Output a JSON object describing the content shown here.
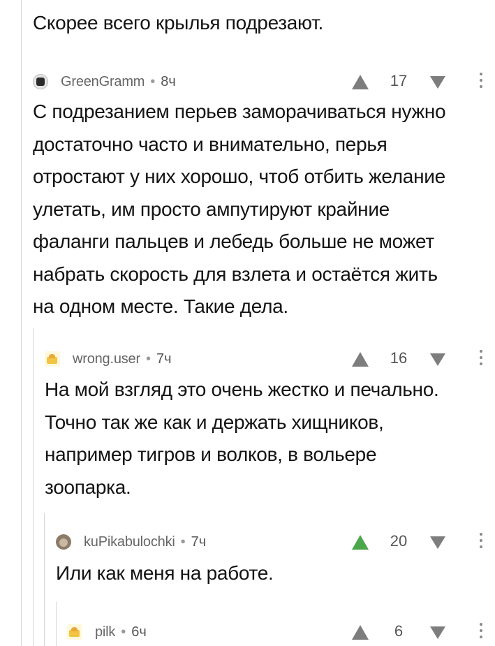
{
  "comments": [
    {
      "text": "Скорее всего крылья подрезают."
    },
    {
      "author": "GreenGramm",
      "separator": "•",
      "time": "8ч",
      "score": "17",
      "avatar_icon": "avatar-icon",
      "text": "С подрезанием перьев заморачиваться нужно\nдостаточно часто и внимательно, перья\nотростают у них хорошо, чтоб отбить желание\nулетать, им просто ампутируют крайние\nфаланги пальцев и лебедь больше не может\nнабрать скорость для взлета и остаётся жить\nна одном месте. Такие дела."
    },
    {
      "author": "wrong.user",
      "separator": "•",
      "time": "7ч",
      "score": "16",
      "avatar_icon": "avatar-icon",
      "text": "На мой взгляд это очень жестко и печально.\nТочно так же как и держать хищников,\nнапример тигров и волков, в вольере\nзоопарка."
    },
    {
      "author": "kuPikabulochki",
      "separator": "•",
      "time": "7ч",
      "score": "20",
      "upvoted": true,
      "avatar_icon": "avatar-icon",
      "text": "Или как меня на работе."
    },
    {
      "author": "pilk",
      "separator": "•",
      "time": "6ч",
      "score": "6",
      "avatar_icon": "avatar-icon"
    }
  ],
  "colors": {
    "thread_line": "#d6d6d6",
    "upvote_active": "#4ca64c",
    "vote_icon": "#7d7d7d",
    "author_text": "#666666"
  }
}
